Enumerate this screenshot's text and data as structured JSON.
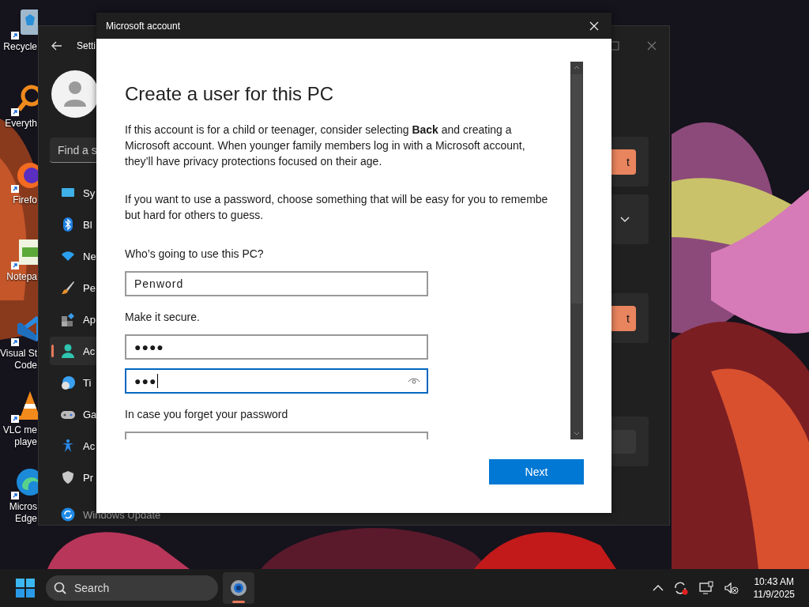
{
  "desktop_icons": [
    {
      "kind": "recycle",
      "lines": [
        "Recycle"
      ]
    },
    {
      "kind": "search",
      "lines": [
        "Everyth"
      ]
    },
    {
      "kind": "firefox",
      "lines": [
        "Firefo"
      ]
    },
    {
      "kind": "notepad",
      "lines": [
        "Notepa"
      ]
    },
    {
      "kind": "vscode",
      "lines": [
        "Visual St",
        "Code"
      ]
    },
    {
      "kind": "vlc",
      "lines": [
        "VLC me",
        "playe"
      ]
    },
    {
      "kind": "edge",
      "lines": [
        "Micros",
        "Edge"
      ]
    }
  ],
  "settings": {
    "title": "Setti",
    "search": {
      "placeholder": "Find a s"
    },
    "nav": [
      {
        "kind": "system",
        "label": "Sy",
        "selected": false
      },
      {
        "kind": "bluetooth",
        "label": "Bl",
        "selected": false
      },
      {
        "kind": "network",
        "label": "Ne",
        "selected": false
      },
      {
        "kind": "personalization",
        "label": "Pe",
        "selected": false
      },
      {
        "kind": "apps",
        "label": "Ap",
        "selected": false
      },
      {
        "kind": "accounts",
        "label": "Ac",
        "selected": true
      },
      {
        "kind": "time",
        "label": "Ti",
        "selected": false
      },
      {
        "kind": "gaming",
        "label": "Ga",
        "selected": false
      },
      {
        "kind": "accessibility",
        "label": "Ac",
        "selected": false
      },
      {
        "kind": "privacy",
        "label": "Pr",
        "selected": false
      },
      {
        "kind": "update",
        "label": "Windows Update",
        "selected": false
      }
    ],
    "cards": [
      {
        "kind": "button",
        "label": "t"
      },
      {
        "kind": "expander"
      },
      {
        "kind": "button",
        "label": "t"
      },
      {
        "kind": "disabled"
      }
    ]
  },
  "dialog": {
    "title": "Microsoft account",
    "heading": "Create a user for this PC",
    "paragraphs": [
      "If this account is for a child or teenager, consider selecting **Back** and creating a\nMicrosoft account. When younger family members log in with a Microsoft account,\nthey’ll have privacy protections focused on their age.",
      "If you want to use a password, choose something that will be easy for you to remembe\nbut hard for others to guess."
    ],
    "form": [
      {
        "kind": "label",
        "text": "Who’s going to use this PC?"
      },
      {
        "kind": "field",
        "value": "Penword",
        "focused": false
      },
      {
        "kind": "label",
        "text": "Make it secure."
      },
      {
        "kind": "field",
        "value": "●●●●",
        "focused": false
      },
      {
        "kind": "field",
        "value": "●●●",
        "focused": true
      },
      {
        "kind": "label",
        "text": "In case you forget your password"
      },
      {
        "kind": "field",
        "focused": false
      }
    ],
    "next": "Next"
  },
  "taskbar": {
    "search": "Search",
    "apps": [
      {
        "kind": "settings",
        "selected": true
      }
    ],
    "time": "10:43 AM",
    "date": "11/9/2025"
  }
}
